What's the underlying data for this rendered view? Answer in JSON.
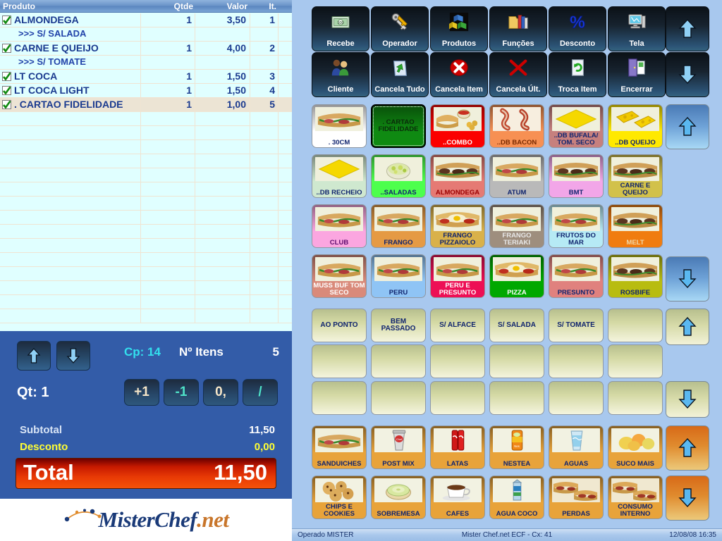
{
  "order_grid": {
    "columns": [
      "Produto",
      "Qtde",
      "Valor",
      "It."
    ],
    "rows": [
      {
        "name": "ALMONDEGA",
        "qty": "1",
        "value": "3,50",
        "it": "1",
        "checked": true,
        "sub": false,
        "alt": false
      },
      {
        "name": ">>> S/ SALADA",
        "qty": "",
        "value": "",
        "it": "",
        "checked": false,
        "sub": true,
        "alt": false
      },
      {
        "name": "CARNE E QUEIJO",
        "qty": "1",
        "value": "4,00",
        "it": "2",
        "checked": true,
        "sub": false,
        "alt": false
      },
      {
        "name": ">>> S/ TOMATE",
        "qty": "",
        "value": "",
        "it": "",
        "checked": false,
        "sub": true,
        "alt": false
      },
      {
        "name": "LT COCA",
        "qty": "1",
        "value": "1,50",
        "it": "3",
        "checked": true,
        "sub": false,
        "alt": false
      },
      {
        "name": "LT COCA LIGHT",
        "qty": "1",
        "value": "1,50",
        "it": "4",
        "checked": true,
        "sub": false,
        "alt": false
      },
      {
        "name": ". CARTAO FIDELIDADE",
        "qty": "1",
        "value": "1,00",
        "it": "5",
        "checked": true,
        "sub": false,
        "alt": true
      }
    ],
    "empty_row_count": 15
  },
  "totals_panel": {
    "scroll_up_icon": "arrow-up-icon",
    "scroll_down_icon": "arrow-down-icon",
    "cp_label": "Cp: 14",
    "items_label": "Nº Itens",
    "items_count": "5",
    "qty_label": "Qt: 1",
    "keys": [
      {
        "label": "+1",
        "name": "increment-key"
      },
      {
        "label": "-1",
        "name": "decrement-key"
      },
      {
        "label": "0,",
        "name": "zero-comma-key"
      },
      {
        "label": "/",
        "name": "divide-key"
      }
    ],
    "subtotal_label": "Subtotal",
    "subtotal_value": "11,50",
    "discount_label": "Desconto",
    "discount_value": "0,00",
    "total_label": "Total",
    "total_value": "11,50"
  },
  "logo": {
    "part1": "MisterChef",
    "part2": ".net"
  },
  "function_buttons": [
    {
      "label": "Recebe",
      "icon": "money-icon"
    },
    {
      "label": "Operador",
      "icon": "keys-icon"
    },
    {
      "label": "Produtos",
      "icon": "blocks-icon"
    },
    {
      "label": "Funções",
      "icon": "folder-books-icon"
    },
    {
      "label": "Desconto",
      "icon": "percent-icon"
    },
    {
      "label": "Tela",
      "icon": "monitor-icon"
    },
    {
      "label": "Cliente",
      "icon": "people-icon"
    },
    {
      "label": "Cancela Tudo",
      "icon": "recycle-bin-icon"
    },
    {
      "label": "Cancela Item",
      "icon": "red-x-circle-icon"
    },
    {
      "label": "Cancela Últ.",
      "icon": "red-x-icon"
    },
    {
      "label": "Troca Item",
      "icon": "refresh-page-icon"
    },
    {
      "label": "Encerrar",
      "icon": "exit-door-icon"
    }
  ],
  "side_arrows": [
    {
      "name": "func-scroll-up",
      "icon": "arrow-up-icon",
      "style": "dark"
    },
    {
      "name": "func-scroll-down",
      "icon": "arrow-down-icon",
      "style": "dark"
    },
    {
      "name": "grid-scroll-up-1",
      "icon": "arrow-up-icon",
      "style": "blue"
    },
    {
      "name": "grid-scroll-down-1",
      "icon": "arrow-down-icon",
      "style": "blue"
    },
    {
      "name": "grid-scroll-up-2",
      "icon": "arrow-up-icon",
      "style": "olive"
    },
    {
      "name": "grid-scroll-down-2",
      "icon": "arrow-down-icon",
      "style": "olive"
    },
    {
      "name": "grid-scroll-up-3",
      "icon": "arrow-up-icon",
      "style": "orange"
    },
    {
      "name": "grid-scroll-down-3",
      "icon": "arrow-down-icon",
      "style": "orange"
    }
  ],
  "product_grid": {
    "rows": [
      [
        {
          "label": ". 30CM",
          "bg": "#ffffff",
          "fg": "#10246e",
          "img": "sandwich",
          "selected": false
        },
        {
          "label": ". CARTAO FIDELIDADE",
          "bg": "#0f8a12",
          "fg": "#0a2c0a",
          "img": "none",
          "selected": true
        },
        {
          "label": "..COMBO",
          "bg": "#fb0000",
          "fg": "#ffffff",
          "img": "combo",
          "selected": false
        },
        {
          "label": "..DB BACON",
          "bg": "#f79053",
          "fg": "#7a2a00",
          "img": "bacon",
          "selected": false
        },
        {
          "label": "..DB BUFALA/ TOM. SECO",
          "bg": "#c6807e",
          "fg": "#10246e",
          "img": "cheese-slice",
          "selected": false
        },
        {
          "label": "..DB QUEIJO",
          "bg": "#ffe900",
          "fg": "#10246e",
          "img": "cheese",
          "selected": false
        }
      ],
      [
        {
          "label": "..DB RECHEIO",
          "bg": "#cfe8cf",
          "fg": "#10246e",
          "img": "cheese-slice",
          "selected": false
        },
        {
          "label": "..SALADAS",
          "bg": "#4dff4d",
          "fg": "#10246e",
          "img": "salad",
          "selected": false
        },
        {
          "label": "ALMONDEGA",
          "bg": "#e57a74",
          "fg": "#9b0000",
          "img": "sandwich-dark",
          "selected": false
        },
        {
          "label": "ATUM",
          "bg": "#b9b9b9",
          "fg": "#10246e",
          "img": "sandwich",
          "selected": false
        },
        {
          "label": "BMT",
          "bg": "#f2a6e8",
          "fg": "#10246e",
          "img": "sandwich-dark",
          "selected": false
        },
        {
          "label": "CARNE E QUEIJO",
          "bg": "#d2c14a",
          "fg": "#10246e",
          "img": "sandwich-dark",
          "selected": false
        }
      ],
      [
        {
          "label": "CLUB",
          "bg": "#fba6e0",
          "fg": "#5d0b6d",
          "img": "sandwich",
          "selected": false
        },
        {
          "label": "FRANGO",
          "bg": "#e59a44",
          "fg": "#10246e",
          "img": "sandwich",
          "selected": false
        },
        {
          "label": "FRANGO PIZZAIOLO",
          "bg": "#d9b14a",
          "fg": "#10246e",
          "img": "pizza-sub",
          "selected": false
        },
        {
          "label": "FRANGO TERIAKI",
          "bg": "#9e8e7e",
          "fg": "#e8e8e8",
          "img": "sandwich",
          "selected": false
        },
        {
          "label": "FRUTOS DO MAR",
          "bg": "#b6eaf5",
          "fg": "#10246e",
          "img": "sandwich",
          "selected": false
        },
        {
          "label": "MELT",
          "bg": "#f07c10",
          "fg": "#f0d8a8",
          "img": "sandwich-dark",
          "selected": false
        }
      ],
      [
        {
          "label": "MUSS BUF TOM SECO",
          "bg": "#d98a7a",
          "fg": "#ffffff",
          "img": "sandwich",
          "selected": false
        },
        {
          "label": "PERU",
          "bg": "#8fc4f5",
          "fg": "#10246e",
          "img": "sandwich",
          "selected": false
        },
        {
          "label": "PERU E PRESUNTO",
          "bg": "#ed0f55",
          "fg": "#ffffff",
          "img": "sandwich",
          "selected": false
        },
        {
          "label": "PIZZA",
          "bg": "#00a800",
          "fg": "#ffffff",
          "img": "pizza-sub",
          "selected": false
        },
        {
          "label": "PRESUNTO",
          "bg": "#e0817e",
          "fg": "#10246e",
          "img": "sandwich",
          "selected": false
        },
        {
          "label": "ROSBIFE",
          "bg": "#b8bc10",
          "fg": "#10246e",
          "img": "sandwich-dark",
          "selected": false
        }
      ],
      [
        {
          "label": "AO PONTO",
          "plain": true
        },
        {
          "label": "BEM PASSADO",
          "plain": true
        },
        {
          "label": "S/ ALFACE",
          "plain": true
        },
        {
          "label": "S/ SALADA",
          "plain": true
        },
        {
          "label": "S/ TOMATE",
          "plain": true
        },
        {
          "label": "",
          "plain": true
        }
      ],
      [
        {
          "label": "",
          "plain": true
        },
        {
          "label": "",
          "plain": true
        },
        {
          "label": "",
          "plain": true
        },
        {
          "label": "",
          "plain": true
        },
        {
          "label": "",
          "plain": true
        },
        {
          "label": "",
          "plain": true
        }
      ],
      [
        {
          "label": "",
          "plain": true
        },
        {
          "label": "",
          "plain": true
        },
        {
          "label": "",
          "plain": true
        },
        {
          "label": "",
          "plain": true
        },
        {
          "label": "",
          "plain": true
        },
        {
          "label": "",
          "plain": true
        }
      ],
      [
        {
          "label": "SANDUICHES",
          "bg": "#e8a33a",
          "fg": "#10246e",
          "img": "sandwich",
          "selected": false
        },
        {
          "label": "POST MIX",
          "bg": "#e8a33a",
          "fg": "#10246e",
          "img": "cup",
          "selected": false
        },
        {
          "label": "LATAS",
          "bg": "#e8a33a",
          "fg": "#10246e",
          "img": "can-red",
          "selected": false
        },
        {
          "label": "NESTEA",
          "bg": "#e8a33a",
          "fg": "#10246e",
          "img": "can-orange",
          "selected": false
        },
        {
          "label": "AGUAS",
          "bg": "#e8a33a",
          "fg": "#10246e",
          "img": "water-glass",
          "selected": false
        },
        {
          "label": "SUCO MAIS",
          "bg": "#e8a33a",
          "fg": "#10246e",
          "img": "fruits",
          "selected": false
        }
      ],
      [
        {
          "label": "CHIPS E COOKIES",
          "bg": "#e8a33a",
          "fg": "#10246e",
          "img": "cookies",
          "selected": false
        },
        {
          "label": "SOBREMESA",
          "bg": "#e8a33a",
          "fg": "#10246e",
          "img": "cake",
          "selected": false
        },
        {
          "label": "CAFES",
          "bg": "#e8a33a",
          "fg": "#10246e",
          "img": "coffee",
          "selected": false
        },
        {
          "label": "AGUA COCO",
          "bg": "#e8a33a",
          "fg": "#10246e",
          "img": "carton",
          "selected": false
        },
        {
          "label": "PERDAS",
          "bg": "#e8a33a",
          "fg": "#10246e",
          "img": "subs-tray",
          "selected": false
        },
        {
          "label": "CONSUMO INTERNO",
          "bg": "#e8a33a",
          "fg": "#10246e",
          "img": "subs-tray",
          "selected": false
        }
      ]
    ]
  },
  "status_bar": {
    "operator": "Operado  MISTER",
    "center": "Mister Chef.net ECF - Cx: 41",
    "datetime": "12/08/08 16:35"
  }
}
